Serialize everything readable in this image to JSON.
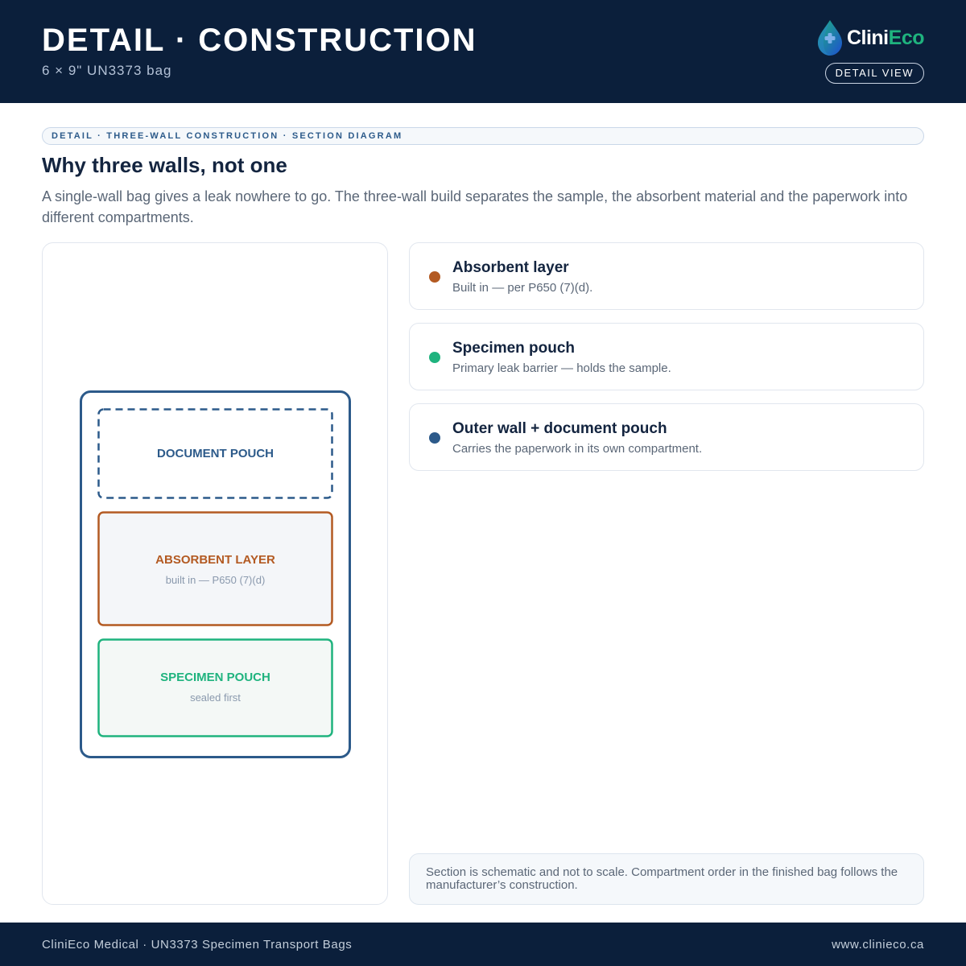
{
  "header": {
    "title": "DETAIL · CONSTRUCTION",
    "subtitle": "6 × 9\" UN3373 bag",
    "brand_part1": "Clini",
    "brand_part2": "Eco",
    "badge": "DETAIL VIEW"
  },
  "main": {
    "eyebrow": "DETAIL · THREE-WALL CONSTRUCTION · SECTION DIAGRAM",
    "heading": "Why three walls, not one",
    "lead": "A single-wall bag gives a leak nowhere to go. The three-wall build separates the sample, the absorbent material and the paperwork into different compartments."
  },
  "diagram": {
    "document_pouch": {
      "label": "DOCUMENT POUCH"
    },
    "absorbent_layer": {
      "label": "ABSORBENT LAYER",
      "sublabel": "built in — P650 (7)(d)"
    },
    "specimen_pouch": {
      "label": "SPECIMEN POUCH",
      "sublabel": "sealed first"
    }
  },
  "legend": [
    {
      "title": "Absorbent layer",
      "desc": "Built in — per P650 (7)(d).",
      "color": "#b35a22"
    },
    {
      "title": "Specimen pouch",
      "desc": "Primary leak barrier — holds the sample.",
      "color": "#1fb37e"
    },
    {
      "title": "Outer wall + document pouch",
      "desc": "Carries the paperwork in its own compartment.",
      "color": "#2c5a8a"
    }
  ],
  "note": "Section is schematic and not to scale. Compartment order in the finished bag follows the manufacturer’s construction.",
  "footer": {
    "left": "CliniEco Medical · UN3373 Specimen Transport Bags",
    "right": "www.clinieco.ca"
  },
  "colors": {
    "navy": "#0b1f3b",
    "outer_wall": "#2c5a8a",
    "absorbent": "#b35a22",
    "specimen": "#1fb37e",
    "brand_green": "#1fb37e"
  }
}
